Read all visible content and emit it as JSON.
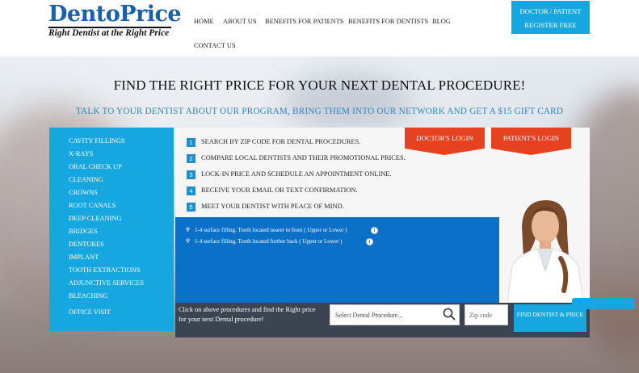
{
  "header": {
    "logo_text": "DentoPrice",
    "logo_tagline": "Right Dentist at the Right Price",
    "nav": [
      "HOME",
      "ABOUT US",
      "BENEFITS FOR PATIENTS",
      "BENEFITS FOR DENTISTS",
      "BLOG",
      "CONTACT US"
    ],
    "cta_line1": "DOCTOR / PATIENT",
    "cta_line2": "REGISTER FREE"
  },
  "hero": {
    "headline": "FIND THE RIGHT PRICE FOR YOUR NEXT DENTAL PROCEDURE!",
    "subline": "TALK TO YOUR DENTIST ABOUT OUR PROGRAM, BRING THEM INTO OUR NETWORK AND GET A $15 GIFT CARD"
  },
  "sidebar": {
    "items": [
      "CAVITY FILLINGS",
      "X-RAYS",
      "ORAL CHECK UP",
      "CLEANING",
      "CROWNS",
      "ROOT CANALS",
      "DEEP CLEANING",
      "BRIDGES",
      "DENTURES",
      "IMPLANT",
      "TOOTH EXTRACTIONS",
      "ADJUNCTIVE SERVICES",
      "BLEACHING",
      "OFFICE VISIT"
    ]
  },
  "steps": [
    {
      "num": "1",
      "text": "SEARCH BY ZIP CODE FOR DENTAL PROCEDURES."
    },
    {
      "num": "2",
      "text": "COMPARE LOCAL DENTISTS AND THEIR PROMOTIONAL PRICES."
    },
    {
      "num": "3",
      "text": "LOCK-IN PRICE AND SCHEDULE AN APPOINTMENT ONLINE."
    },
    {
      "num": "4",
      "text": "RECEIVE YOUR EMAIL OR TEXT CONFIRMATION."
    },
    {
      "num": "5",
      "text": "MEET YOUR DENTIST WITH PEACE OF MIND."
    }
  ],
  "login": {
    "doctor": "DOCTOR'S LOGIN",
    "patient": "PATIENT'S LOGIN"
  },
  "procedures": [
    "1-4 surface filling, Tooth located nearer to front ( Upper or Lower )",
    "1-4 surface filling, Tooth located further back ( Upper or Lower )"
  ],
  "search": {
    "prompt": "Click on above procedures and find the Right price for your next Dental procedure!",
    "select_placeholder": "Select Dental Procedure...",
    "zip_placeholder": "Zip code",
    "button": "FIND DENTIST & PRICE"
  },
  "colors": {
    "accent": "#17a7e0",
    "login": "#e6421f",
    "procedure_box": "#0b70c8",
    "bottom_bar": "#3b4552"
  }
}
